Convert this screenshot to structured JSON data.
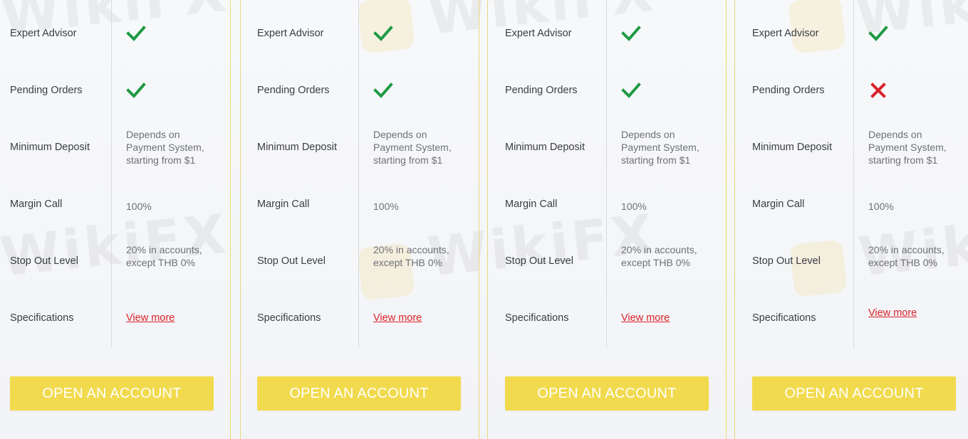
{
  "watermark": "WikiFX",
  "colors": {
    "check": "#1e9a44",
    "cross": "#d8232a",
    "link": "#d8232a",
    "button_bg": "#f2da4e",
    "card_border": "#e9d87a"
  },
  "columns": [
    {
      "rows": [
        {
          "label": "Expert Advisor",
          "value": "check-icon"
        },
        {
          "label": "Pending Orders",
          "value": "check-icon"
        },
        {
          "label": "Minimum Deposit",
          "text": "Depends on\nPayment System,\nstarting from $1"
        },
        {
          "label": "Margin Call",
          "text": "100%"
        },
        {
          "label": "Stop Out Level",
          "text": "20% in accounts,\nexcept THB 0%"
        },
        {
          "label": "Specifications",
          "link": "View more"
        }
      ],
      "button": "OPEN AN ACCOUNT"
    },
    {
      "rows": [
        {
          "label": "Expert Advisor",
          "value": "check-icon"
        },
        {
          "label": "Pending Orders",
          "value": "check-icon"
        },
        {
          "label": "Minimum Deposit",
          "text": "Depends on\nPayment System,\nstarting from $1"
        },
        {
          "label": "Margin Call",
          "text": "100%"
        },
        {
          "label": "Stop Out Level",
          "text": "20% in accounts,\nexcept THB 0%"
        },
        {
          "label": "Specifications",
          "link": "View more"
        }
      ],
      "button": "OPEN AN ACCOUNT"
    },
    {
      "rows": [
        {
          "label": "Expert Advisor",
          "value": "check-icon"
        },
        {
          "label": "Pending Orders",
          "value": "check-icon"
        },
        {
          "label": "Minimum Deposit",
          "text": "Depends on\nPayment System,\nstarting from $1"
        },
        {
          "label": "Margin Call",
          "text": "100%"
        },
        {
          "label": "Stop Out Level",
          "text": "20% in accounts,\nexcept THB 0%"
        },
        {
          "label": "Specifications",
          "link": "View more"
        }
      ],
      "button": "OPEN AN ACCOUNT"
    },
    {
      "rows": [
        {
          "label": "Expert Advisor",
          "value": "check-icon"
        },
        {
          "label": "Pending Orders",
          "value": "cross-icon"
        },
        {
          "label": "Minimum Deposit",
          "text": "Depends on\nPayment System,\nstarting from $1"
        },
        {
          "label": "Margin Call",
          "text": "100%"
        },
        {
          "label": "Stop Out Level",
          "text": "20% in accounts,\nexcept THB 0%"
        },
        {
          "label": "Specifications",
          "link": "View more"
        }
      ],
      "button": "OPEN AN ACCOUNT"
    }
  ]
}
